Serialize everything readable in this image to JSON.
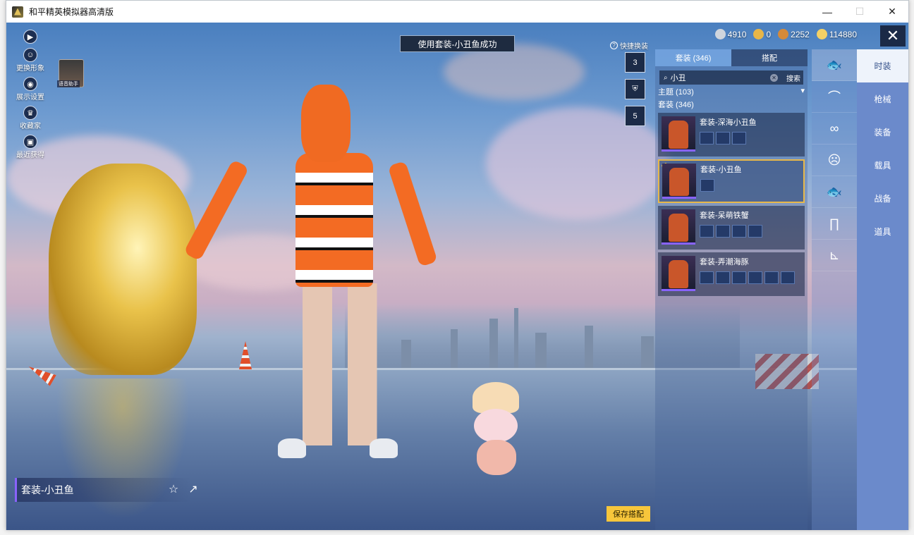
{
  "window": {
    "title": "和平精英模拟器高清版",
    "controls": {
      "minimize": "—",
      "maximize": "☐",
      "close": "✕"
    }
  },
  "left_tools": [
    {
      "name": "play-icon",
      "glyph": "▶",
      "label": ""
    },
    {
      "name": "change-look-icon",
      "glyph": "☺",
      "label": "更换形象"
    },
    {
      "name": "display-settings-icon",
      "glyph": "◉",
      "label": "展示设置"
    },
    {
      "name": "collector-icon",
      "glyph": "♛",
      "label": "收藏家"
    },
    {
      "name": "gift-icon",
      "glyph": "▣",
      "label": "最近获得"
    }
  ],
  "avatar_thumb_label": "语音助手",
  "toast": "使用套装-小丑鱼成功",
  "currency": [
    {
      "icon": "silver-coin-icon",
      "value": "4910",
      "color": "#cfd5dd"
    },
    {
      "icon": "gold-badge-icon",
      "value": "0",
      "color": "#e8b648"
    },
    {
      "icon": "bronze-coin-icon",
      "value": "2252",
      "color": "#d48a3a"
    },
    {
      "icon": "gold-coin-icon",
      "value": "114880",
      "color": "#f4d166"
    }
  ],
  "quick_change": {
    "label": "快捷换装",
    "slots": [
      "3",
      "",
      "5"
    ]
  },
  "outfit_name": "套装-小丑鱼",
  "save_button": "保存搭配",
  "panel": {
    "tabs": [
      "套装 (346)",
      "搭配"
    ],
    "search": {
      "value": "小丑",
      "button": "搜索"
    },
    "theme_label": "主题 (103)",
    "sets_label": "套装 (346)",
    "sets": [
      {
        "title": "套装-深海小丑鱼",
        "pieces": 3,
        "selected": false
      },
      {
        "title": "套装-小丑鱼",
        "pieces": 1,
        "selected": true
      },
      {
        "title": "套装-呆萌铁蟹",
        "pieces": 4,
        "selected": false
      },
      {
        "title": "套装-弄潮海豚",
        "pieces": 6,
        "selected": false
      }
    ]
  },
  "categories": [
    "fish-costume-icon",
    "cap-icon",
    "goggles-icon",
    "mask-icon",
    "fish-costume-icon",
    "pants-icon",
    "shoes-icon"
  ],
  "menu": [
    "时装",
    "枪械",
    "装备",
    "载具",
    "战备",
    "道具"
  ],
  "colors": {
    "accent": "#f7c63b",
    "purple": "#8963ff",
    "menu_bg": "#6b8acb"
  }
}
